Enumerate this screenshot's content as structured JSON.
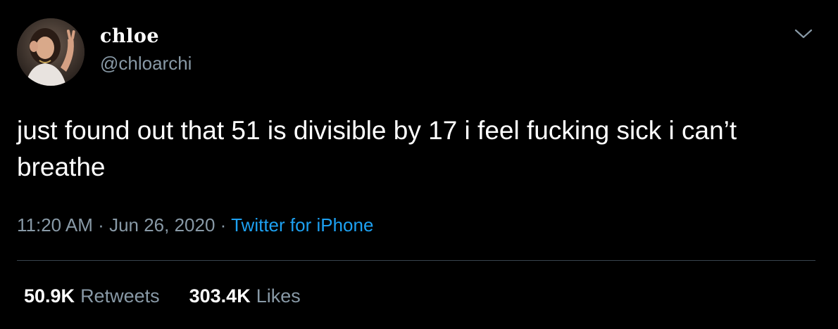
{
  "author": {
    "display_name": "chloe",
    "handle": "@chloarchi"
  },
  "icons": {
    "avatar": "profile-photo",
    "menu": "chevron-down-icon"
  },
  "tweet": {
    "text": "just found out that 51 is divisible by 17 i feel fucking sick i can’t breathe",
    "time": "11:20 AM",
    "separator": "·",
    "date": "Jun 26, 2020",
    "source": "Twitter for iPhone"
  },
  "stats": {
    "retweets_count": "50.9K",
    "retweets_label": "Retweets",
    "likes_count": "303.4K",
    "likes_label": "Likes"
  },
  "colors": {
    "background": "#000000",
    "text_primary": "#ffffff",
    "text_secondary": "#8899a6",
    "link": "#1da1f2",
    "divider": "#38444d"
  }
}
